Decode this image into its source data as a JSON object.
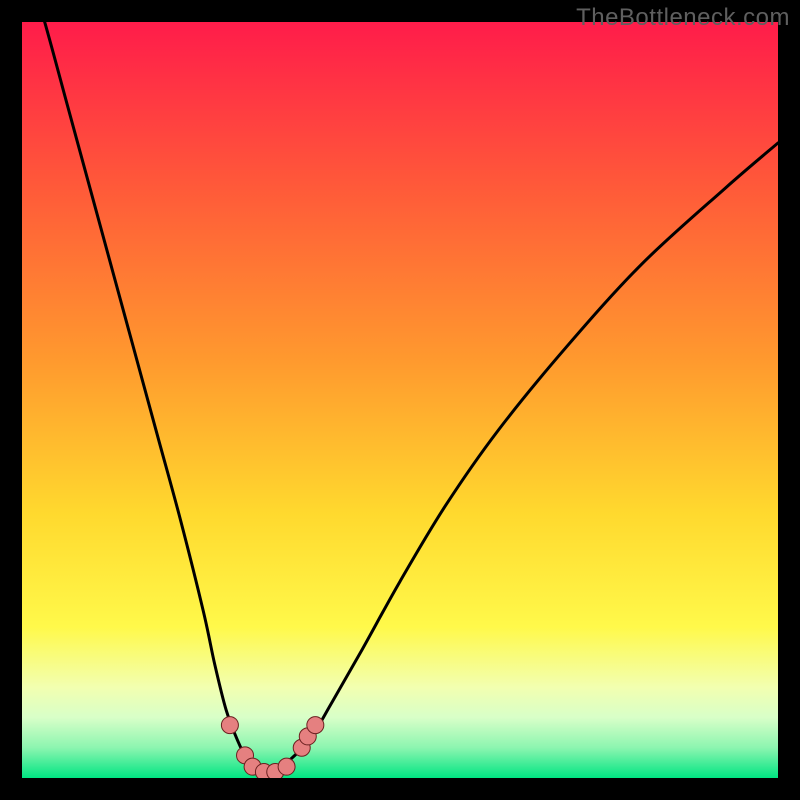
{
  "watermark": "TheBottleneck.com",
  "colors": {
    "frame_bg": "#000000",
    "gradient_top": "#ff1c4a",
    "gradient_mid1": "#ff8a2e",
    "gradient_mid2": "#ffe92e",
    "gradient_bottom1": "#f6ff90",
    "gradient_bottom2": "#00e582",
    "curve_stroke": "#000000",
    "marker_fill": "#e58080",
    "marker_stroke": "#6b2020"
  },
  "chart_data": {
    "type": "line",
    "title": "",
    "xlabel": "",
    "ylabel": "",
    "xlim": [
      0,
      100
    ],
    "ylim": [
      0,
      100
    ],
    "series": [
      {
        "name": "bottleneck-curve",
        "x": [
          0,
          3,
          6,
          9,
          12,
          15,
          18,
          21,
          24,
          25.5,
          27,
          28.5,
          30,
          31,
          32,
          33,
          34,
          35,
          38,
          41,
          45,
          50,
          56,
          63,
          72,
          82,
          93,
          100
        ],
        "y": [
          110,
          100,
          89,
          78,
          67,
          56,
          45,
          34,
          22,
          15,
          9,
          5,
          2,
          1,
          0.5,
          0.5,
          1,
          2,
          5,
          10,
          17,
          26,
          36,
          46,
          57,
          68,
          78,
          84
        ]
      }
    ],
    "markers": [
      {
        "x": 27.5,
        "y": 7
      },
      {
        "x": 29.5,
        "y": 3
      },
      {
        "x": 30.5,
        "y": 1.5
      },
      {
        "x": 32.0,
        "y": 0.8
      },
      {
        "x": 33.5,
        "y": 0.8
      },
      {
        "x": 35.0,
        "y": 1.5
      },
      {
        "x": 37.0,
        "y": 4
      },
      {
        "x": 37.8,
        "y": 5.5
      },
      {
        "x": 38.8,
        "y": 7
      }
    ]
  }
}
